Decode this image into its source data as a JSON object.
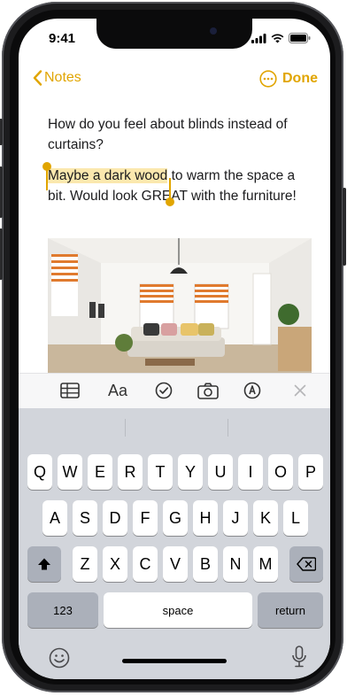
{
  "status": {
    "time": "9:41"
  },
  "nav": {
    "back_label": "Notes",
    "done_label": "Done"
  },
  "note": {
    "paragraph1": "How do you feel about blinds instead of curtains?",
    "selected_text": "Maybe a dark wood",
    "paragraph2_rest": " to warm the space a bit. Would look GREAT with the furniture!"
  },
  "toolbar": {
    "items": [
      {
        "icon": "table-icon"
      },
      {
        "label": "Aa"
      },
      {
        "icon": "checklist-icon"
      },
      {
        "icon": "camera-icon"
      },
      {
        "icon": "markup-pen-icon"
      },
      {
        "icon": "close-icon"
      }
    ]
  },
  "keyboard": {
    "row1": [
      "Q",
      "W",
      "E",
      "R",
      "T",
      "Y",
      "U",
      "I",
      "O",
      "P"
    ],
    "row2": [
      "A",
      "S",
      "D",
      "F",
      "G",
      "H",
      "J",
      "K",
      "L"
    ],
    "row3": [
      "Z",
      "X",
      "C",
      "V",
      "B",
      "N",
      "M"
    ],
    "numbers_label": "123",
    "space_label": "space",
    "return_label": "return"
  },
  "colors": {
    "accent": "#e1a500",
    "selection": "#fbe8ae",
    "keyboard_bg": "#d2d5db"
  }
}
